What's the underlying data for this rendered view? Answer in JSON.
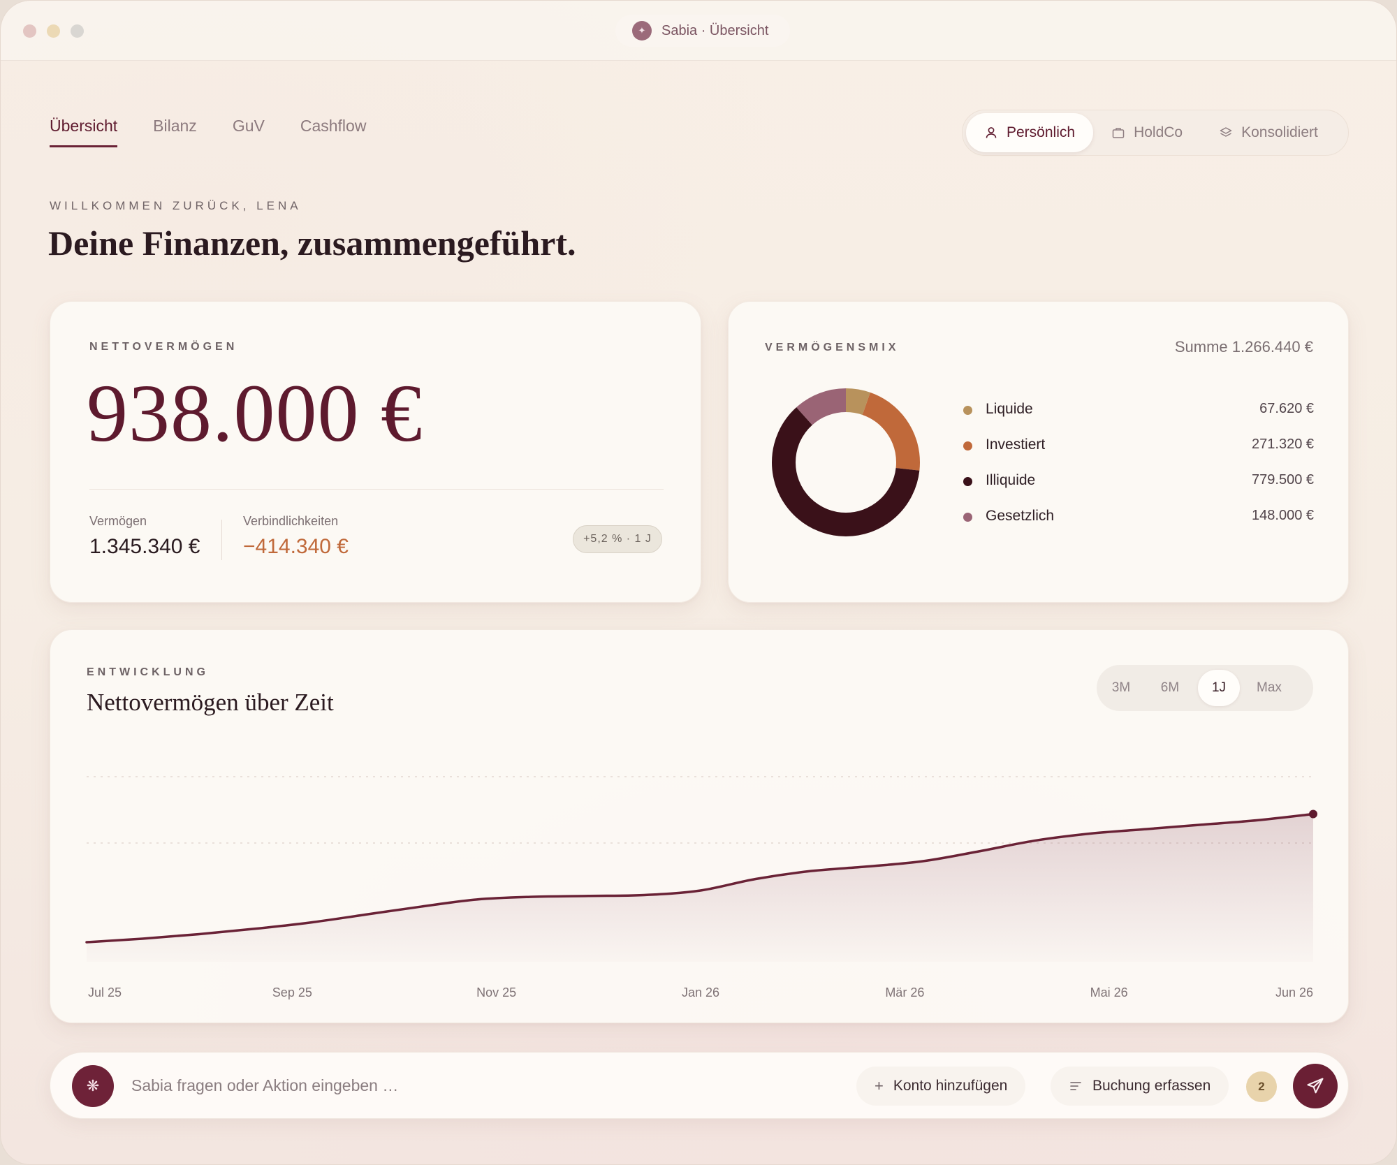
{
  "window": {
    "title": "Sabia · Übersicht"
  },
  "tabs": [
    {
      "label": "Übersicht",
      "active": true
    },
    {
      "label": "Bilanz"
    },
    {
      "label": "GuV"
    },
    {
      "label": "Cashflow"
    }
  ],
  "entities": [
    {
      "label": "Persönlich",
      "icon": "user-icon",
      "active": true
    },
    {
      "label": "HoldCo",
      "icon": "briefcase-icon"
    },
    {
      "label": "Konsolidiert",
      "icon": "layers-icon"
    }
  ],
  "greeting": "WILLKOMMEN ZURÜCK, LENA",
  "headline": "Deine Finanzen, zusammengeführt.",
  "net_worth": {
    "label": "NETTOVERMÖGEN",
    "value": "938.000 €",
    "assets_label": "Vermögen",
    "assets_value": "1.345.340 €",
    "liabilities_label": "Verbindlichkeiten",
    "liabilities_value": "−414.340 €",
    "change_badge": "+5,2 % · 1 J"
  },
  "asset_mix": {
    "label": "VERMÖGENSMIX",
    "sum": "Summe 1.266.440 €",
    "items": [
      {
        "name": "Liquide",
        "value": "67.620 €",
        "amount": 67620,
        "color": "#b8925c"
      },
      {
        "name": "Investiert",
        "value": "271.320 €",
        "amount": 271320,
        "color": "#c0693a"
      },
      {
        "name": "Illiquide",
        "value": "779.500 €",
        "amount": 779500,
        "color": "#3a1119"
      },
      {
        "name": "Gesetzlich",
        "value": "148.000 €",
        "amount": 148000,
        "color": "#9a6475"
      }
    ]
  },
  "development": {
    "eyebrow": "ENTWICKLUNG",
    "title": "Nettovermögen über Zeit",
    "ranges": [
      {
        "label": "3M"
      },
      {
        "label": "6M"
      },
      {
        "label": "1J",
        "active": true
      },
      {
        "label": "Max"
      }
    ]
  },
  "chart_data": {
    "type": "area",
    "title": "Nettovermögen über Zeit",
    "x_tick_labels": [
      "Jul 25",
      "Sep 25",
      "Nov 25",
      "Jan 26",
      "Mär 26",
      "Mai 26",
      "Jun 26"
    ],
    "x": [
      0,
      0.5,
      1,
      1.5,
      2,
      2.5,
      3,
      3.5,
      4,
      4.5,
      5,
      5.5,
      6,
      6.5,
      7,
      7.5,
      8,
      8.5,
      9,
      9.5,
      10,
      10.5,
      11
    ],
    "values": [
      0.09,
      0.11,
      0.135,
      0.165,
      0.2,
      0.245,
      0.29,
      0.33,
      0.345,
      0.35,
      0.355,
      0.38,
      0.445,
      0.49,
      0.515,
      0.545,
      0.6,
      0.66,
      0.7,
      0.725,
      0.75,
      0.775,
      0.81
    ],
    "y_scale": "relative (no y-axis labels shown)",
    "grid": "horizontal dotted",
    "line_color": "#6a2236"
  },
  "command_bar": {
    "placeholder": "Sabia fragen oder Aktion eingeben …",
    "add_account": "Konto hinzufügen",
    "add_booking": "Buchung erfassen",
    "count": "2"
  }
}
